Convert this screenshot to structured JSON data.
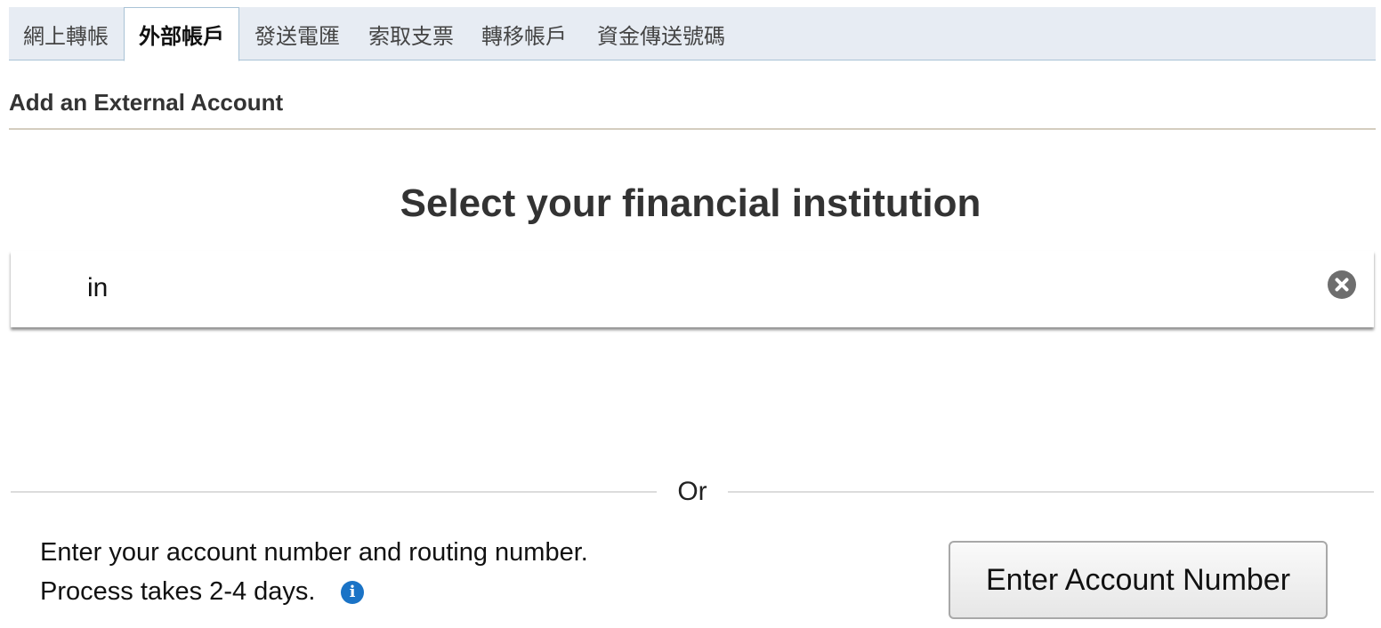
{
  "tabs": [
    {
      "label": "網上轉帳",
      "active": false
    },
    {
      "label": "外部帳戶",
      "active": true
    },
    {
      "label": "發送電匯",
      "active": false
    },
    {
      "label": "索取支票",
      "active": false
    },
    {
      "label": "轉移帳戶",
      "active": false
    },
    {
      "label": "資金傳送號碼",
      "active": false
    }
  ],
  "section": {
    "title": "Add an External Account"
  },
  "main": {
    "title": "Select your financial institution",
    "search_value": "in",
    "clear_icon": "clear-icon"
  },
  "divider": {
    "text": "Or"
  },
  "manual": {
    "line1": "Enter your account number and routing number.",
    "line2": "Process takes 2-4 days.",
    "info_icon": "info-icon",
    "info_glyph": "i",
    "button_label": "Enter Account Number"
  },
  "colors": {
    "tab_background": "#e7ecf3",
    "tab_border": "#a9c3d6",
    "info_blue": "#1a73c6",
    "clear_gray": "#6e6e6e"
  }
}
